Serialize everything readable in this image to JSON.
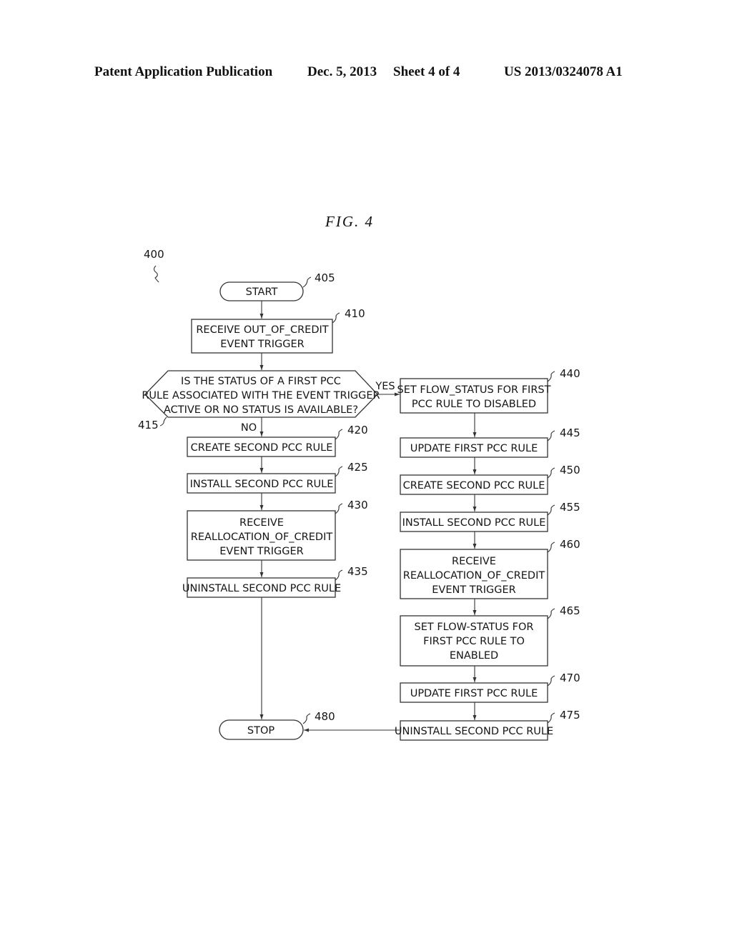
{
  "header": {
    "left": "Patent Application Publication",
    "date": "Dec. 5, 2013",
    "sheet": "Sheet 4 of 4",
    "number": "US 2013/0324078 A1"
  },
  "figure": {
    "title": "FIG.  4",
    "ref": "400"
  },
  "nodes": {
    "n405": {
      "ref": "405",
      "lines": [
        "START"
      ]
    },
    "n410": {
      "ref": "410",
      "lines": [
        "RECEIVE OUT_OF_CREDIT",
        "EVENT TRIGGER"
      ]
    },
    "n415": {
      "ref": "415",
      "lines": [
        "IS THE STATUS OF A FIRST PCC",
        "RULE ASSOCIATED WITH THE EVENT TRIGGER",
        "ACTIVE OR NO STATUS IS AVAILABLE?"
      ],
      "yes": "YES",
      "no": "NO"
    },
    "n420": {
      "ref": "420",
      "lines": [
        "CREATE SECOND PCC RULE"
      ]
    },
    "n425": {
      "ref": "425",
      "lines": [
        "INSTALL SECOND PCC RULE"
      ]
    },
    "n430": {
      "ref": "430",
      "lines": [
        "RECEIVE",
        "REALLOCATION_OF_CREDIT",
        "EVENT TRIGGER"
      ]
    },
    "n435": {
      "ref": "435",
      "lines": [
        "UNINSTALL SECOND PCC RULE"
      ]
    },
    "n440": {
      "ref": "440",
      "lines": [
        "SET FLOW_STATUS FOR FIRST",
        "PCC RULE TO DISABLED"
      ]
    },
    "n445": {
      "ref": "445",
      "lines": [
        "UPDATE FIRST PCC RULE"
      ]
    },
    "n450": {
      "ref": "450",
      "lines": [
        "CREATE SECOND PCC RULE"
      ]
    },
    "n455": {
      "ref": "455",
      "lines": [
        "INSTALL SECOND PCC RULE"
      ]
    },
    "n460": {
      "ref": "460",
      "lines": [
        "RECEIVE",
        "REALLOCATION_OF_CREDIT",
        "EVENT TRIGGER"
      ]
    },
    "n465": {
      "ref": "465",
      "lines": [
        "SET FLOW-STATUS FOR",
        "FIRST PCC RULE TO",
        "ENABLED"
      ]
    },
    "n470": {
      "ref": "470",
      "lines": [
        "UPDATE FIRST PCC RULE"
      ]
    },
    "n475": {
      "ref": "475",
      "lines": [
        "UNINSTALL SECOND PCC RULE"
      ]
    },
    "n480": {
      "ref": "480",
      "lines": [
        "STOP"
      ]
    }
  }
}
